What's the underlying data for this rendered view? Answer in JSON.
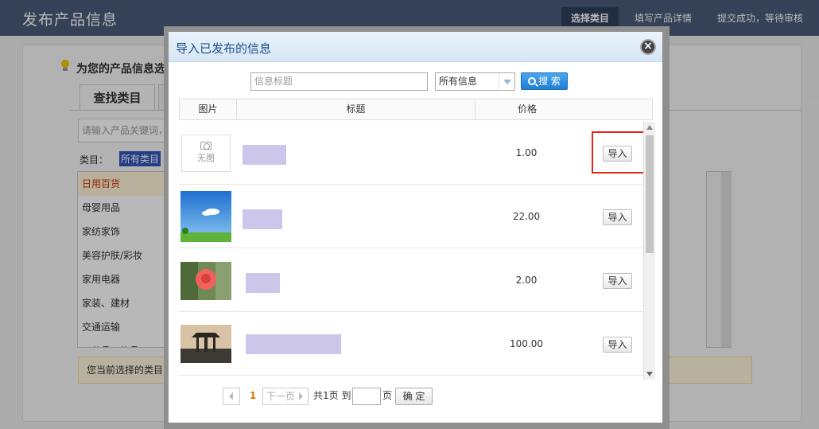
{
  "header": {
    "title": "发布产品信息",
    "steps": [
      "选择类目",
      "填写产品详情",
      "提交成功，等待审核"
    ]
  },
  "background": {
    "tip_title": "为您的产品信息选",
    "tab_find": "查找类目",
    "keyword_placeholder": "请输入产品关键词，",
    "category_label": "类目：",
    "category_all": "所有类目",
    "categories": [
      "日用百货",
      "母婴用品",
      "家纺家饰",
      "美容护肤/彩妆",
      "家用电器",
      "家装、建材",
      "交通运输",
      "工艺品、礼品"
    ],
    "selected_label": "您当前选择的类目"
  },
  "modal": {
    "title": "导入已发布的信息",
    "search_placeholder": "信息标题",
    "filter_value": "所有信息",
    "search_button": "搜 索",
    "columns": {
      "image": "图片",
      "title": "标题",
      "price": "价格"
    },
    "rows": [
      {
        "image": "none",
        "no_image_text": "无图",
        "price": "1.00",
        "action": "导入"
      },
      {
        "image": "sky",
        "price": "22.00",
        "action": "导入"
      },
      {
        "image": "rose",
        "price": "2.00",
        "action": "导入"
      },
      {
        "image": "pavilion",
        "price": "100.00",
        "action": "导入"
      }
    ],
    "pager": {
      "current": "1",
      "next": "下一页",
      "total_prefix": "共1页 到",
      "page_unit": "页",
      "confirm": "确 定"
    }
  },
  "colors": {
    "header_bg": "#4a5a78",
    "highlight": "#e0261e",
    "search_button": "#1e7fd4",
    "redacted_title": "#ccc6ea"
  }
}
